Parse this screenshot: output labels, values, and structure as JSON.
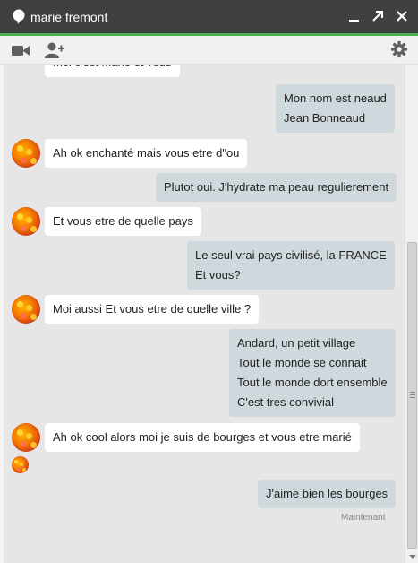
{
  "window": {
    "title": "marie fremont",
    "icons": {
      "title": "chat-bubble-icon",
      "minimize": "minimize-icon",
      "popout": "popout-arrow-icon",
      "close": "close-icon"
    },
    "accent_color": "#4caf50",
    "titlebar_color": "#404040"
  },
  "toolbar": {
    "icons": [
      "video-camera-icon",
      "add-person-icon",
      "gear-icon"
    ]
  },
  "messages": [
    {
      "from": "contact",
      "lines": [
        "moi c'est Marie et vous"
      ]
    },
    {
      "from": "me",
      "lines": [
        "Mon nom est neaud",
        "Jean Bonneaud"
      ]
    },
    {
      "from": "contact",
      "lines": [
        "Ah ok enchanté mais vous etre d\"ou"
      ]
    },
    {
      "from": "me",
      "lines": [
        "Plutot oui. J'hydrate ma peau regulierement"
      ]
    },
    {
      "from": "contact",
      "lines": [
        "Et vous etre de quelle pays"
      ]
    },
    {
      "from": "me",
      "lines": [
        "Le seul vrai pays civilisé, la FRANCE",
        "Et vous?"
      ]
    },
    {
      "from": "contact",
      "lines": [
        "Moi aussi Et vous etre de quelle ville ?"
      ]
    },
    {
      "from": "me",
      "lines": [
        "Andard, un petit village",
        "Tout le monde se connait",
        "Tout le monde dort ensemble",
        "C'est tres convivial"
      ]
    },
    {
      "from": "contact",
      "lines": [
        "Ah ok cool alors moi je suis de bourges et vous etre marié"
      ]
    },
    {
      "from": "me",
      "lines": [
        "J'aime bien les bourges"
      ]
    }
  ],
  "timestamp": "Maintenant",
  "colors": {
    "incoming_bubble": "#ffffff",
    "outgoing_bubble": "#cfd8dc",
    "conversation_bg": "#e6e6e6"
  }
}
